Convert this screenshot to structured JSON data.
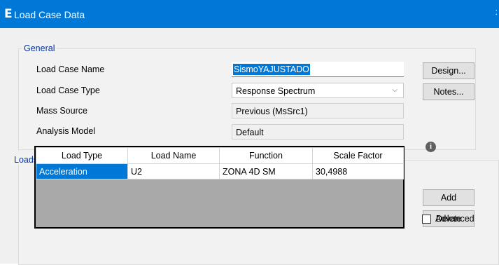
{
  "window": {
    "icon_glyph": "E",
    "title": "Load Case Data",
    "close_glyph": ":"
  },
  "general": {
    "group_title": "General",
    "load_case_name_label": "Load Case Name",
    "load_case_name_value": "SismoYAJUSTADO",
    "load_case_type_label": "Load Case Type",
    "load_case_type_value": "Response Spectrum",
    "mass_source_label": "Mass Source",
    "mass_source_value": "Previous  (MsSrc1)",
    "analysis_model_label": "Analysis Model",
    "analysis_model_value": "Default",
    "design_button": "Design...",
    "notes_button": "Notes..."
  },
  "loads_applied": {
    "group_title": "Loads Applied",
    "columns": [
      "Load Type",
      "Load Name",
      "Function",
      "Scale Factor"
    ],
    "rows": [
      [
        "Acceleration",
        "U2",
        "ZONA 4D SM",
        "30,4988"
      ]
    ],
    "info_icon_glyph": "i",
    "add_button": "Add",
    "delete_button": "Delete",
    "advanced_label": "Advanced",
    "advanced_checked": false
  },
  "colors": {
    "titlebar": "#0078d7",
    "selection": "#0078d7",
    "group_title": "#0033a0"
  },
  "icons": {
    "app": "etabs-e-icon",
    "dropdown": "chevron-down-icon",
    "info": "info-icon"
  }
}
